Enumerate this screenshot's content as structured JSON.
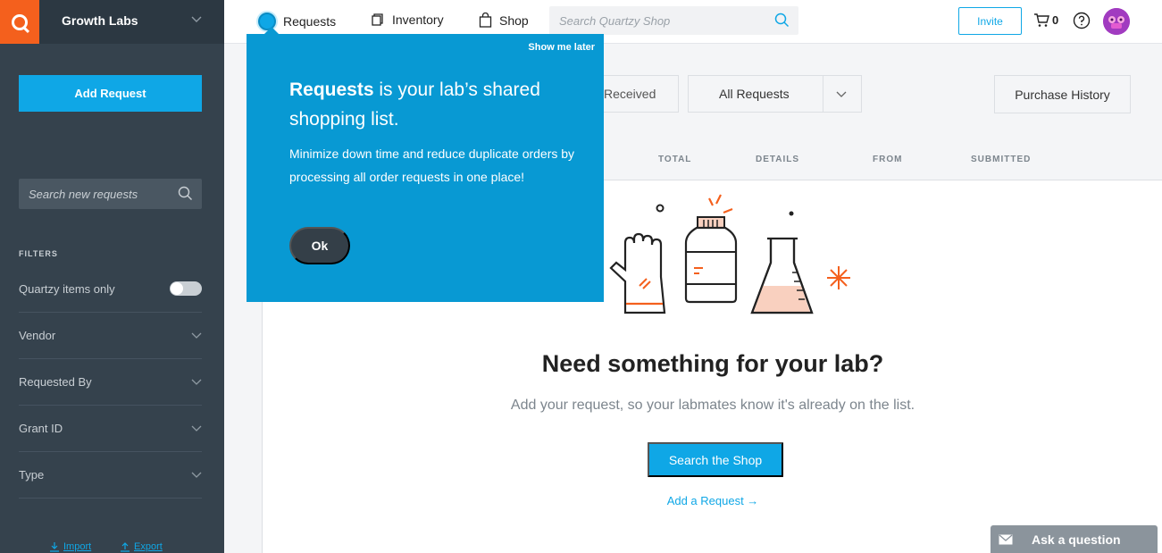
{
  "sidebar": {
    "lab_name": "Growth Labs",
    "add_request": "Add Request",
    "search_placeholder": "Search new requests",
    "filters_label": "FILTERS",
    "quartzy_only": "Quartzy items only",
    "quartzy_only_enabled": false,
    "filters": [
      "Vendor",
      "Requested By",
      "Grant ID",
      "Type"
    ],
    "import": "Import",
    "export": "Export"
  },
  "nav": {
    "requests": "Requests",
    "inventory": "Inventory",
    "shop": "Shop",
    "search_placeholder": "Search Quartzy Shop",
    "invite": "Invite",
    "cart_count": "0"
  },
  "main": {
    "received_tab": "Received",
    "requests_filter": "All Requests",
    "purchase_history": "Purchase History",
    "columns": [
      "TOTAL",
      "DETAILS",
      "FROM",
      "SUBMITTED"
    ],
    "empty_title": "Need something for your lab?",
    "empty_subtitle": "Add your request, so your labmates know it's already on the list.",
    "search_shop": "Search the Shop",
    "add_request_link": "Add a Request →"
  },
  "popover": {
    "show_later": "Show me later",
    "headline_bold": "Requests",
    "headline_rest": " is your lab’s shared shopping list.",
    "body": "Minimize down time and reduce duplicate orders by processing all order requests in one place!",
    "ok": "Ok"
  },
  "ask_question": "Ask a question",
  "colors": {
    "accent": "#0fa7e6",
    "sidebar_bg": "#35424d",
    "logo_orange": "#f4601d",
    "popover_bg": "#0899d3"
  }
}
